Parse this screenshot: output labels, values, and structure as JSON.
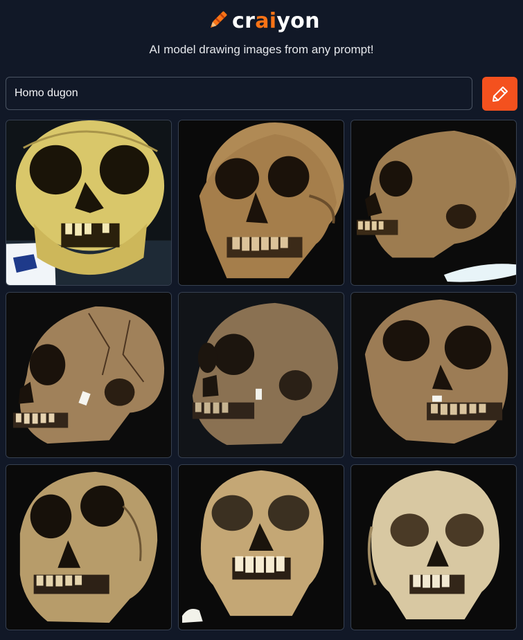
{
  "brand": {
    "name_pre": "cr",
    "name_ai": "ai",
    "name_post": "yon",
    "tagline": "AI model drawing images from any prompt!",
    "accent": "#f97316"
  },
  "prompt": {
    "value": "Homo dugon",
    "button_icon": "pencil-icon"
  },
  "gallery": {
    "images": [
      {
        "subject": "skull-front-yellow"
      },
      {
        "subject": "skull-three-quarter"
      },
      {
        "subject": "skull-side-right"
      },
      {
        "subject": "skull-side-left"
      },
      {
        "subject": "skull-side-left-dark"
      },
      {
        "subject": "skull-three-quarter-right"
      },
      {
        "subject": "skull-three-quarter-left"
      },
      {
        "subject": "skull-front"
      },
      {
        "subject": "skull-front-pale"
      }
    ]
  },
  "colors": {
    "background": "#111827",
    "button": "#f4511e"
  }
}
